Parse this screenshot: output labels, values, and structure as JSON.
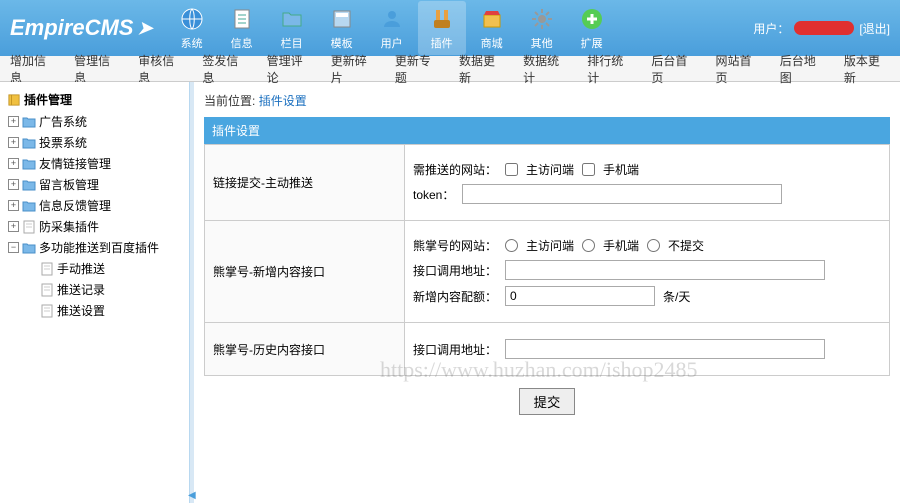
{
  "header": {
    "logo": "EmpireCMS",
    "nav": [
      {
        "label": "系统",
        "icon": "globe"
      },
      {
        "label": "信息",
        "icon": "doc"
      },
      {
        "label": "栏目",
        "icon": "folder"
      },
      {
        "label": "模板",
        "icon": "template"
      },
      {
        "label": "用户",
        "icon": "user"
      },
      {
        "label": "插件",
        "icon": "plugin",
        "active": true
      },
      {
        "label": "商城",
        "icon": "shop"
      },
      {
        "label": "其他",
        "icon": "gear"
      },
      {
        "label": "扩展",
        "icon": "plus"
      }
    ],
    "user_label": "用户：",
    "logout": "[退出]"
  },
  "submenu": [
    "增加信息",
    "管理信息",
    "审核信息",
    "签发信息",
    "管理评论",
    "更新碎片",
    "更新专题",
    "数据更新",
    "数据统计",
    "排行统计",
    "后台首页",
    "网站首页",
    "后台地图",
    "版本更新"
  ],
  "sidebar": {
    "title": "插件管理",
    "nodes": [
      {
        "label": "广告系统",
        "type": "folder"
      },
      {
        "label": "投票系统",
        "type": "folder"
      },
      {
        "label": "友情链接管理",
        "type": "folder"
      },
      {
        "label": "留言板管理",
        "type": "folder"
      },
      {
        "label": "信息反馈管理",
        "type": "folder"
      },
      {
        "label": "防采集插件",
        "type": "file"
      },
      {
        "label": "多功能推送到百度插件",
        "type": "folder",
        "expanded": true,
        "children": [
          {
            "label": "手动推送"
          },
          {
            "label": "推送记录"
          },
          {
            "label": "推送设置"
          }
        ]
      }
    ]
  },
  "content": {
    "breadcrumb_label": "当前位置:",
    "breadcrumb_link": "插件设置",
    "panel_title": "插件设置",
    "rows": [
      {
        "label": "链接提交-主动推送",
        "fields": {
          "site_label": "需推送的网站：",
          "cb_pc": "主访问端",
          "cb_mobile": "手机端",
          "token_label": "token："
        }
      },
      {
        "label": "熊掌号-新增内容接口",
        "fields": {
          "site_label": "熊掌号的网站：",
          "rb_pc": "主访问端",
          "rb_mobile": "手机端",
          "rb_none": "不提交",
          "api_label": "接口调用地址：",
          "quota_label": "新增内容配额：",
          "quota_value": "0",
          "quota_unit": "条/天"
        }
      },
      {
        "label": "熊掌号-历史内容接口",
        "fields": {
          "api_label": "接口调用地址："
        }
      }
    ],
    "submit": "提交"
  },
  "watermark": "https://www.huzhan.com/ishop2485"
}
